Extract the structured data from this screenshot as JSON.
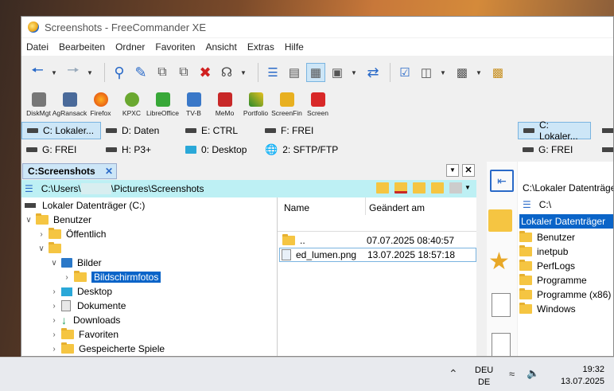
{
  "window": {
    "title": "Screenshots - FreeCommander XE"
  },
  "menu": [
    "Datei",
    "Bearbeiten",
    "Ordner",
    "Favoriten",
    "Ansicht",
    "Extras",
    "Hilfe"
  ],
  "tools": [
    "DiskMgt",
    "AgRansack",
    "Firefox",
    "KPXC",
    "LibreOffice",
    "TV-B",
    "MeMo",
    "Portfolio",
    "ScreenFin",
    "Screen"
  ],
  "drives_left": {
    "row1": [
      "C: Lokaler...",
      "D: Daten",
      "E: CTRL",
      "F: FREI"
    ],
    "row2": [
      "G: FREI",
      "H: P3+",
      "0: Desktop",
      "2: SFTP/FTP"
    ]
  },
  "drives_right": {
    "row1": [
      "C: Lokaler..."
    ],
    "row2": [
      "G: FREI"
    ]
  },
  "left_panel": {
    "tab": "C:Screenshots",
    "path_prefix": "C:\\Users\\",
    "path_suffix": "\\Pictures\\Screenshots",
    "tree": [
      {
        "label": "Lokaler Datenträger (C:)"
      },
      {
        "label": "Benutzer"
      },
      {
        "label": "Öffentlich"
      },
      {
        "label": ""
      },
      {
        "label": "Bilder"
      },
      {
        "label": "Bildschirmfotos"
      },
      {
        "label": "Desktop"
      },
      {
        "label": "Dokumente"
      },
      {
        "label": "Downloads"
      },
      {
        "label": "Favoriten"
      },
      {
        "label": "Gespeicherte Spiele"
      }
    ],
    "columns": {
      "name": "Name",
      "date": "Geändert am"
    },
    "files": [
      {
        "name": "..",
        "date": "07.07.2025 08:40:57"
      },
      {
        "name": "ed_lumen.png",
        "date": "13.07.2025 18:57:18"
      }
    ]
  },
  "right_panel": {
    "path": "C:\\Lokaler Datenträger",
    "crumb": "C:\\",
    "tree_header": "Lokaler Datenträger",
    "items": [
      "Benutzer",
      "inetpub",
      "PerfLogs",
      "Programme",
      "Programme (x86)",
      "Windows"
    ]
  },
  "taskbar": {
    "lang1": "DEU",
    "lang2": "DE",
    "time": "19:32",
    "date": "13.07.2025"
  }
}
